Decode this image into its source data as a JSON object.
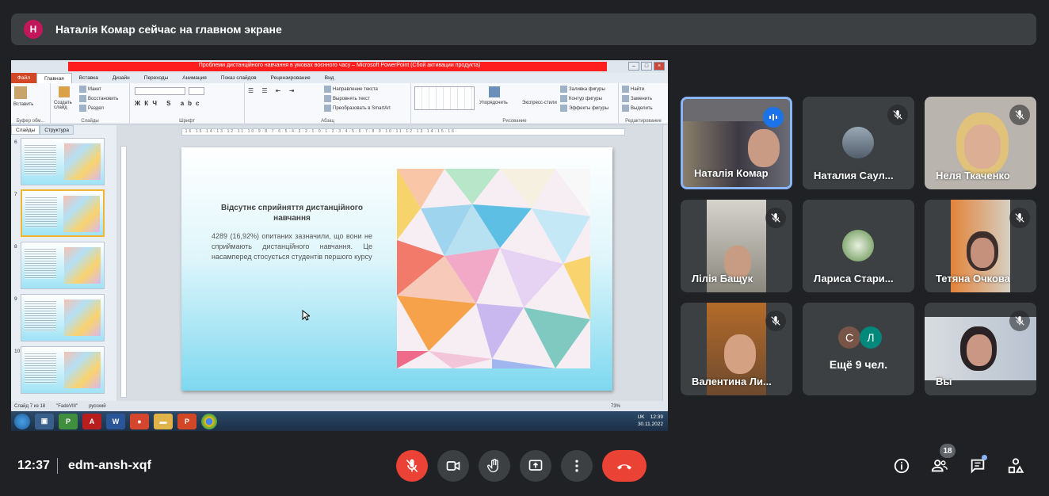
{
  "banner": {
    "avatar_letter": "Н",
    "avatar_color": "#c2185b",
    "text": "Наталія Комар сейчас на главном экране"
  },
  "ppt": {
    "title": "Проблеми дистанційного навчання в умовах воєнного часу – Microsoft PowerPoint (Сбой активации продукта)",
    "tabs": [
      "Файл",
      "Главная",
      "Вставка",
      "Дизайн",
      "Переходы",
      "Анимация",
      "Показ слайдов",
      "Рецензирование",
      "Вид"
    ],
    "ribbon": {
      "paste": "Вставить",
      "clipboard": "Буфер обм...",
      "create_slide": "Создать слайд",
      "layout": "Макет",
      "reset": "Восстановить",
      "section": "Раздел",
      "slides_group": "Слайды",
      "font_group": "Шрифт",
      "paragraph_group": "Абзац",
      "text_dir": "Направление текста",
      "align_text": "Выровнять текст",
      "smartart": "Преобразовать в SmartArt",
      "arrange": "Упорядочить",
      "quick_styles": "Экспресс-стили",
      "fill": "Заливка фигуры",
      "outline": "Контур фигуры",
      "effects": "Эффекты фигуры",
      "drawing_group": "Рисование",
      "find": "Найти",
      "replace": "Заменить",
      "select": "Выделить",
      "editing_group": "Редактирование"
    },
    "panel_tabs": [
      "Слайды",
      "Структура"
    ],
    "thumb_numbers": [
      "6",
      "7",
      "8",
      "9",
      "10"
    ],
    "slide": {
      "heading": "Відсутнє сприйняття дистанційного навчання",
      "body": "4289 (16,92%) опитаних зазначили, що вони не сприймають дистанційного навчання. Це насамперед стосується студентів першого курсу"
    },
    "status": {
      "slide_info": "Слайд 7 из 18",
      "theme": "\"FadeVIII\"",
      "lang": "русский",
      "zoom": "73%"
    },
    "taskbar": {
      "lang": "UK",
      "time": "12:39",
      "date": "30.11.2022"
    }
  },
  "participants": [
    {
      "name": "Наталія Комар",
      "muted": false,
      "active": true
    },
    {
      "name": "Наталия Саул...",
      "muted": true
    },
    {
      "name": "Неля Ткаченко",
      "muted": true
    },
    {
      "name": "Лілія Бащук",
      "muted": true
    },
    {
      "name": "Лариса Стари...",
      "muted": true
    },
    {
      "name": "Тетяна Очкова",
      "muted": true
    },
    {
      "name": "Валентина Ли...",
      "muted": true
    },
    {
      "name": "Ещё 9 чел.",
      "avatars": [
        "С",
        "Л"
      ]
    },
    {
      "name": "Вы",
      "muted": true
    }
  ],
  "more_label": "Ещё 9 чел.",
  "more_avatars": [
    "С",
    "Л"
  ],
  "bottom": {
    "time": "12:37",
    "meeting_code": "edm-ansh-xqf",
    "people_count": "18"
  },
  "icons": [
    "mic-off-icon",
    "camera-icon",
    "hand-icon",
    "present-icon",
    "more-icon",
    "end-call-icon",
    "info-icon",
    "people-icon",
    "chat-icon",
    "activities-icon"
  ],
  "colors": {
    "background": "#202124",
    "tile": "#3c4043",
    "accent": "#8ab4f8",
    "danger": "#ea4335"
  }
}
